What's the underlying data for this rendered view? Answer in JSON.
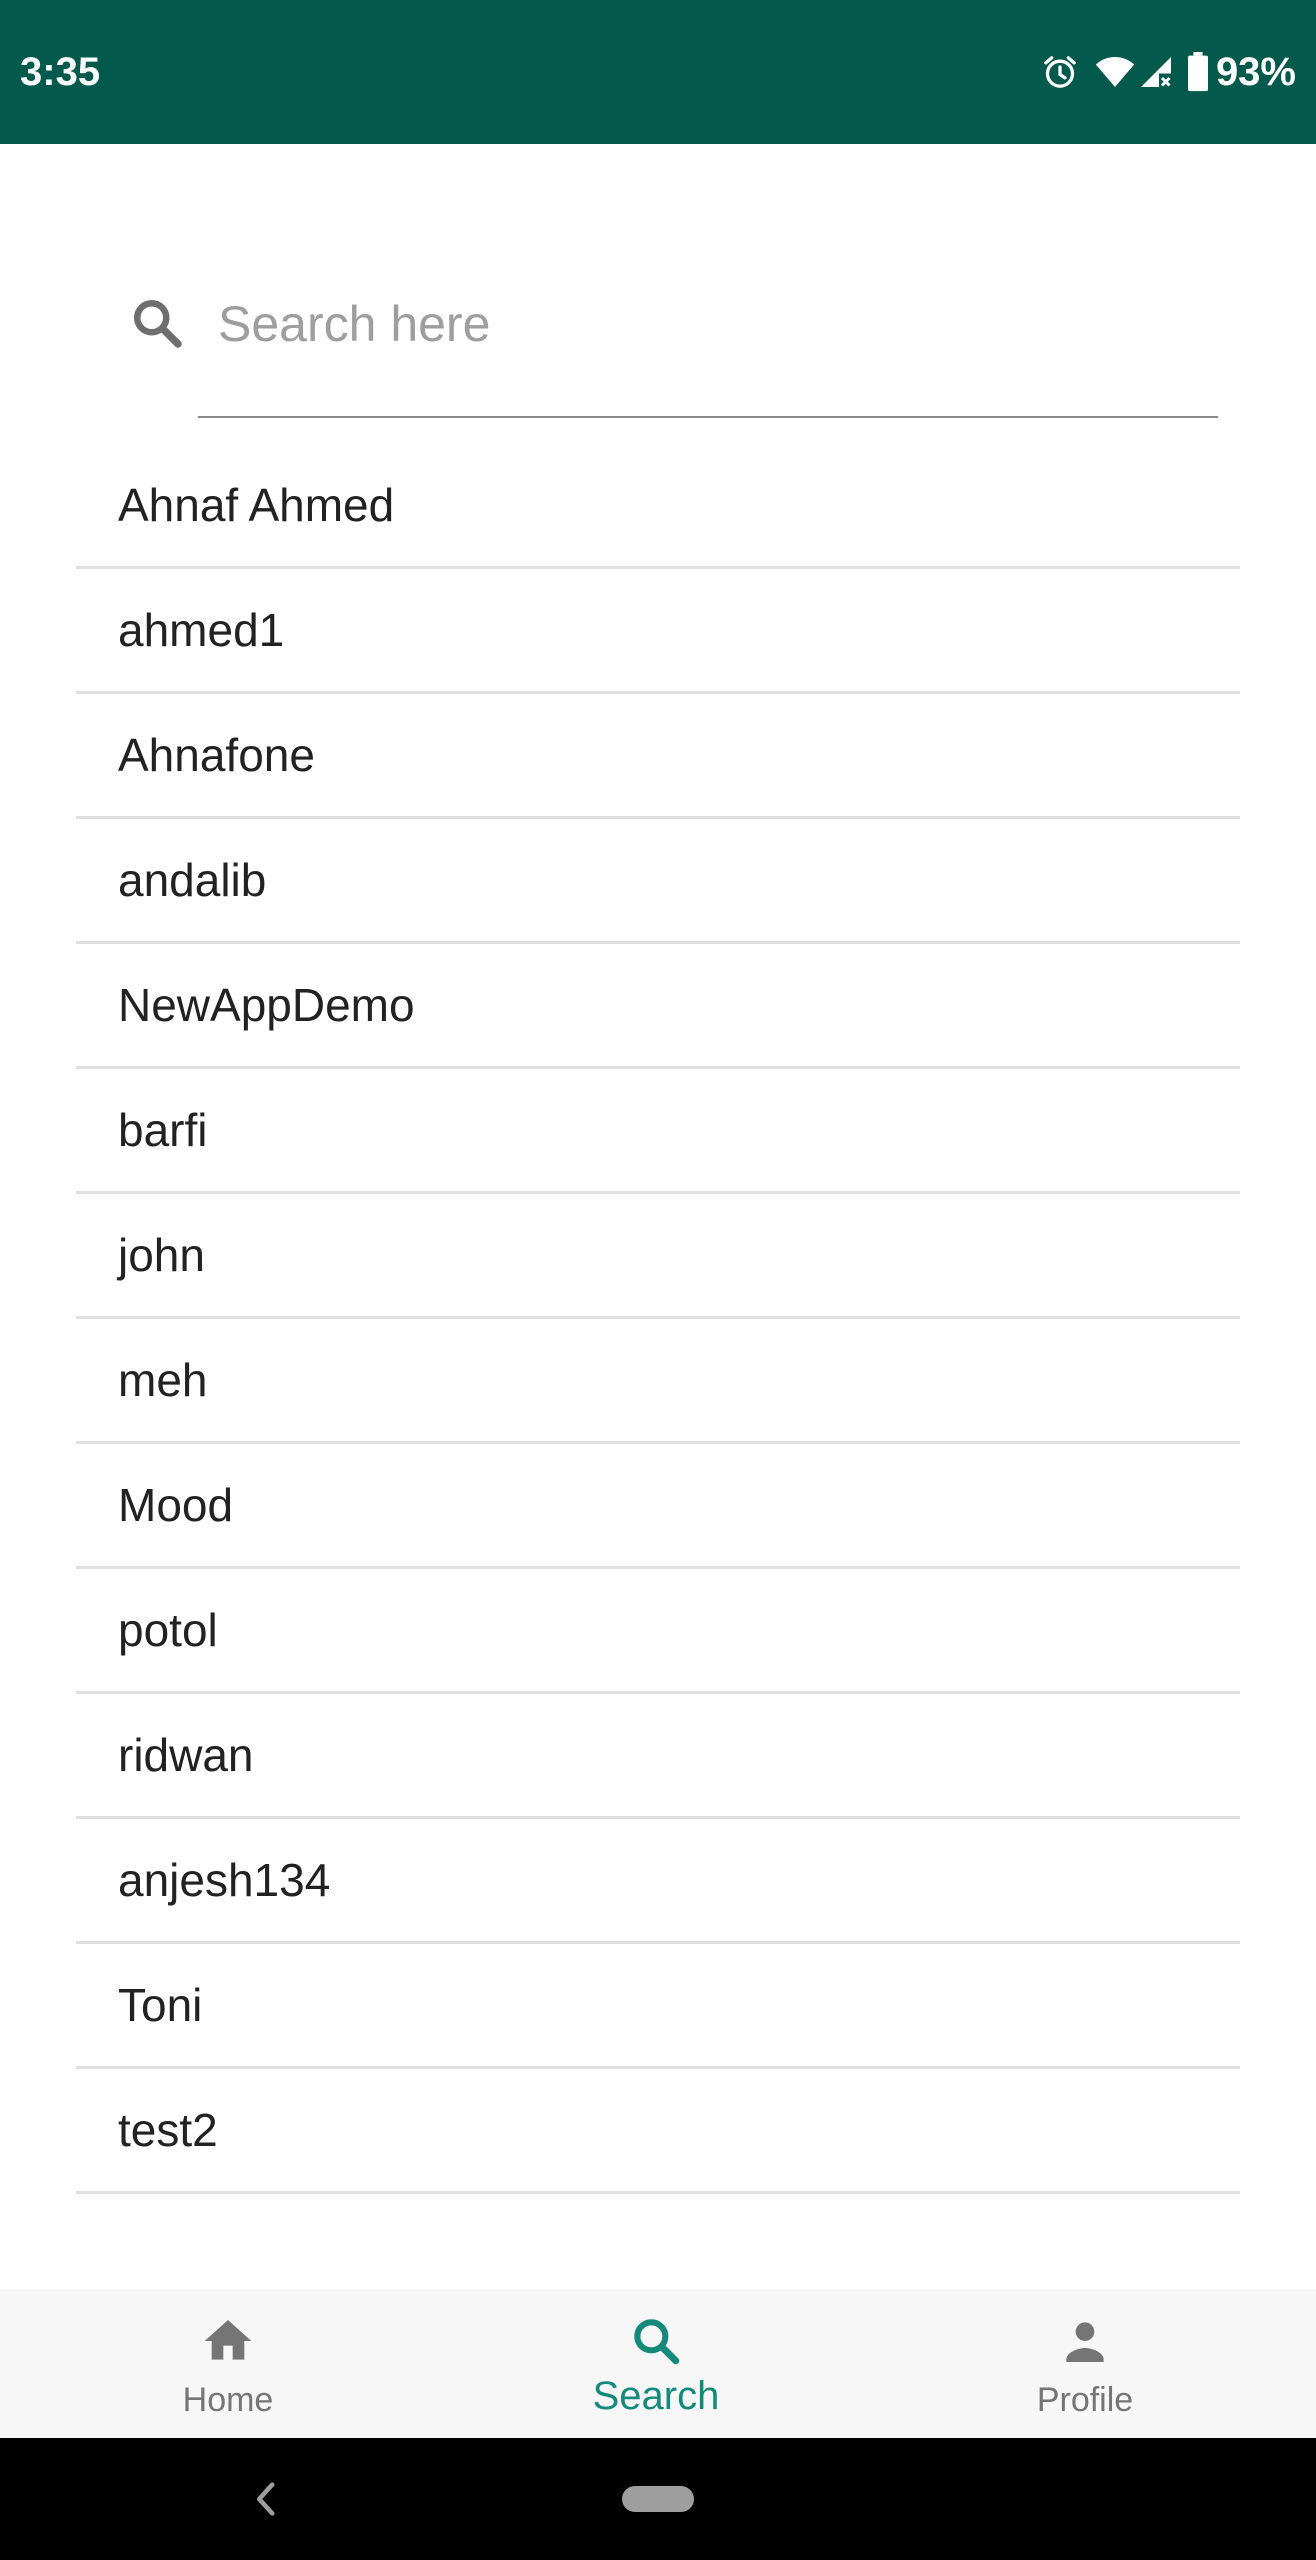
{
  "status_bar": {
    "time": "3:35",
    "battery_percent": "93%",
    "icons": [
      "alarm-icon",
      "wifi-icon",
      "signal-icon",
      "battery-icon"
    ],
    "background_color": "#02594C"
  },
  "search": {
    "placeholder": "Search here",
    "value": ""
  },
  "users": [
    {
      "name": "Ahnaf Ahmed"
    },
    {
      "name": "ahmed1"
    },
    {
      "name": "Ahnafone"
    },
    {
      "name": "andalib"
    },
    {
      "name": "NewAppDemo"
    },
    {
      "name": "barfi"
    },
    {
      "name": "john"
    },
    {
      "name": "meh"
    },
    {
      "name": "Mood"
    },
    {
      "name": "potol"
    },
    {
      "name": "ridwan"
    },
    {
      "name": "anjesh134"
    },
    {
      "name": "Toni"
    },
    {
      "name": "test2"
    }
  ],
  "bottom_nav": {
    "items": [
      {
        "label": "Home",
        "icon": "home-icon",
        "active": false
      },
      {
        "label": "Search",
        "icon": "search-icon",
        "active": true
      },
      {
        "label": "Profile",
        "icon": "person-icon",
        "active": false
      }
    ],
    "active_color": "#138a7c",
    "inactive_color": "#757575"
  }
}
